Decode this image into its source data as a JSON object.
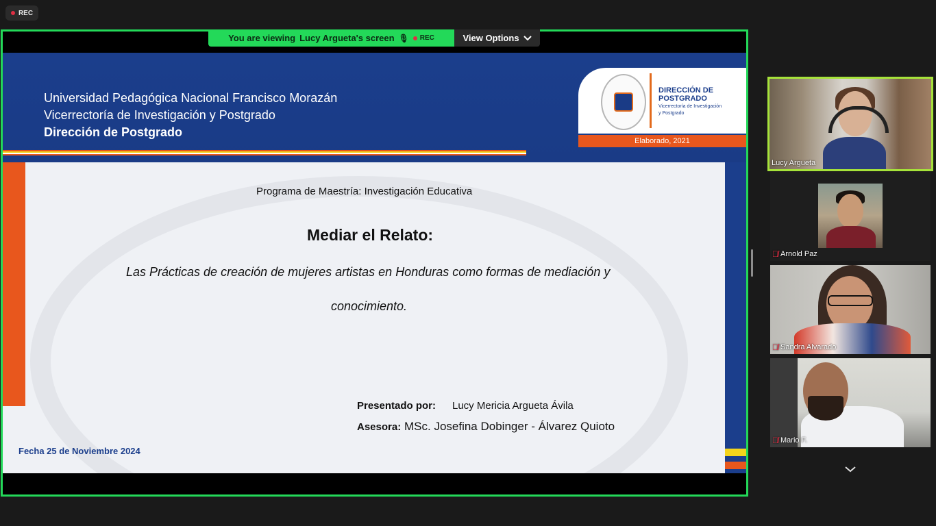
{
  "recording": {
    "badge_label": "REC"
  },
  "share_bar": {
    "viewing_prefix": "You are viewing",
    "presenter": "Lucy Argueta's screen",
    "rec_label": "REC",
    "view_options_label": "View Options",
    "accent_color": "#23d959"
  },
  "slide": {
    "header_lines": [
      "Universidad Pedagógica Nacional Francisco Morazán",
      "Vicerrectoría de Investigación y Postgrado",
      "Dirección de Postgrado"
    ],
    "logo": {
      "title_line1": "DIRECCIÓN DE",
      "title_line2": "POSTGRADO",
      "sub_line1": "Vicerrectoría de Investigación",
      "sub_line2": "y Postgrado",
      "strip": "Elaborado, 2021"
    },
    "program": "Programa de Maestría: Investigación Educativa",
    "title": "Mediar el Relato:",
    "subtitle_line1": "Las Prácticas de creación de mujeres artistas en Honduras como formas de mediación y",
    "subtitle_line2": "conocimiento.",
    "presented_label": "Presentado por:",
    "presented_name": "Lucy Mericia Argueta Ávila",
    "advisor_label": "Asesora:",
    "advisor_name": "MSc. Josefina Dobinger - Álvarez Quioto",
    "date": "Fecha 25 de Noviembre 2024",
    "colors": {
      "blue": "#1b3e8c",
      "orange": "#e8571d",
      "yellow": "#f3d41c"
    }
  },
  "participants": [
    {
      "name": "Lucy Argueta",
      "muted": false,
      "active_speaker": true
    },
    {
      "name": "Arnold Paz",
      "muted": true
    },
    {
      "name": "Sandra Alvarado",
      "muted": true
    },
    {
      "name": "Mario F.",
      "muted": true
    }
  ],
  "icons": {
    "muted": "muted-mic-icon",
    "more": "chevron-down-icon"
  }
}
